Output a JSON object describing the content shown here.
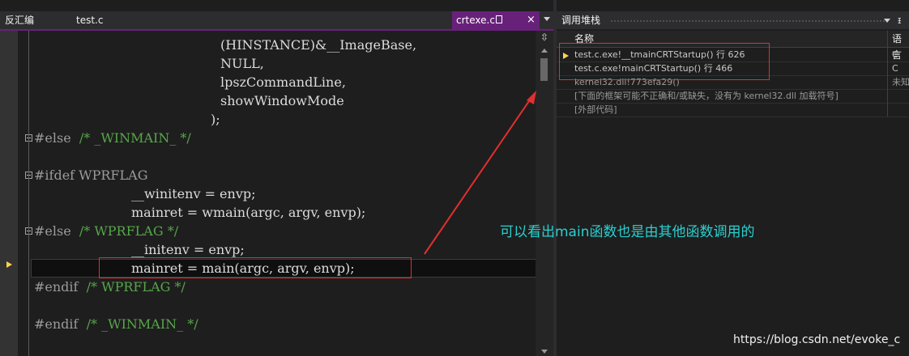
{
  "top_tabs": {
    "disassembly": "反汇编",
    "file_tab": "test.c",
    "active_tab": "crtexe.c",
    "close_glyph": "×"
  },
  "code_lines": [
    {
      "kind": "text",
      "text": "(HINSTANCE)&__ImageBase,"
    },
    {
      "kind": "text",
      "text": "NULL,"
    },
    {
      "kind": "text",
      "text": "lpszCommandLine,"
    },
    {
      "kind": "text",
      "text": "showWindowMode"
    },
    {
      "kind": "text",
      "text": ");"
    },
    {
      "kind": "pp",
      "text": "#else",
      "comment": "/* _WINMAIN_ */"
    },
    {
      "kind": "blank",
      "text": ""
    },
    {
      "kind": "pp",
      "text": "#ifdef WPRFLAG",
      "comment": ""
    },
    {
      "kind": "text",
      "text": "__winitenv = envp;"
    },
    {
      "kind": "text",
      "text": "mainret = wmain(argc, argv, envp);"
    },
    {
      "kind": "pp",
      "text": "#else",
      "comment": "/* WPRFLAG */"
    },
    {
      "kind": "text",
      "text": "__initenv = envp;"
    },
    {
      "kind": "text",
      "text": "mainret = main(argc, argv, envp);"
    },
    {
      "kind": "pp",
      "text": "#endif",
      "comment": "/* WPRFLAG */"
    },
    {
      "kind": "blank",
      "text": ""
    },
    {
      "kind": "pp",
      "text": "#endif",
      "comment": "/* _WINMAIN_ */"
    }
  ],
  "call_stack": {
    "title": "调用堆栈",
    "col_name": "名称",
    "col_lang": "语言",
    "rows": [
      {
        "name": "test.c.exe!__tmainCRTStartup() 行 626",
        "lang": "C",
        "current": true
      },
      {
        "name": "test.c.exe!mainCRTStartup() 行 466",
        "lang": "C",
        "current": false
      },
      {
        "name": "kernel32.dll!773efa29()",
        "lang": "未知",
        "current": false
      },
      {
        "name": "[下面的框架可能不正确和/或缺失，没有为 kernel32.dll 加载符号]",
        "lang": "",
        "current": false
      },
      {
        "name": "[外部代码]",
        "lang": "",
        "current": false
      }
    ]
  },
  "annotation": "可以看出main函数也是由其他函数调用的",
  "watermark": "https://blog.csdn.net/evoke_c",
  "colors": {
    "accent_tab": "#68217a",
    "annotation": "#2ad0d0",
    "highlight": "#e03030",
    "current_marker": "#ffd34d"
  }
}
